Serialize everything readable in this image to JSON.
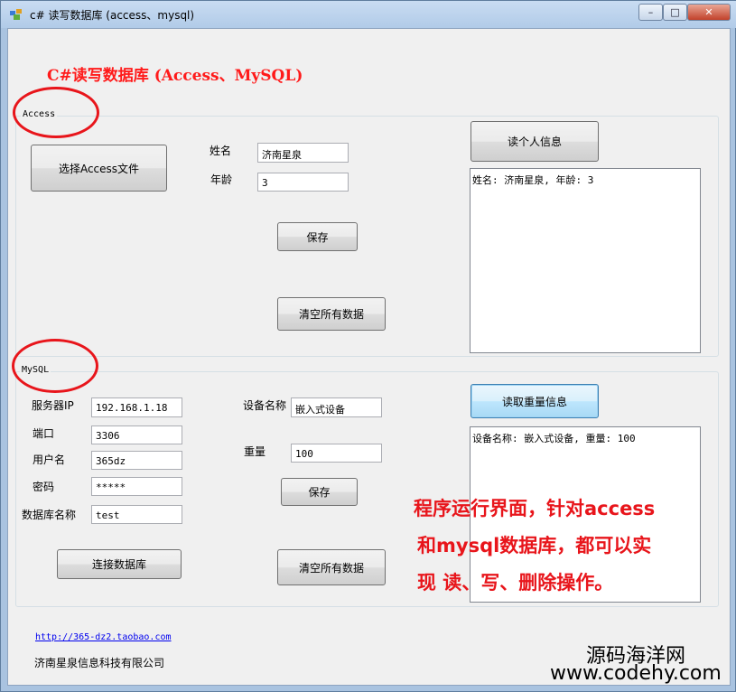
{
  "window": {
    "title": "c# 读写数据库 (access、mysql)",
    "controls": {
      "minimize": "–",
      "maximize": "□",
      "close": "✕"
    }
  },
  "heading": "C#读写数据库 (Access、MySQL)",
  "access": {
    "group_label": "Access",
    "select_file_button": "选择Access文件",
    "name_label": "姓名",
    "name_value": "济南星泉",
    "age_label": "年龄",
    "age_value": "3",
    "save_button": "保存",
    "clear_button": "清空所有数据",
    "read_button": "读个人信息",
    "output": "姓名: 济南星泉, 年龄: 3"
  },
  "mysql": {
    "group_label": "MySQL",
    "server_ip_label": "服务器IP",
    "server_ip_value": "192.168.1.18",
    "port_label": "端口",
    "port_value": "3306",
    "username_label": "用户名",
    "username_value": "365dz",
    "password_label": "密码",
    "password_value": "*****",
    "dbname_label": "数据库名称",
    "dbname_value": "test",
    "connect_button": "连接数据库",
    "device_name_label": "设备名称",
    "device_name_value": "嵌入式设备",
    "weight_label": "重量",
    "weight_value": "100",
    "save_button": "保存",
    "clear_button": "清空所有数据",
    "read_button": "读取重量信息",
    "output": "设备名称: 嵌入式设备, 重量: 100"
  },
  "footer": {
    "link": "http://365-dz2.taobao.com",
    "company": "济南星泉信息科技有限公司"
  },
  "annotation": {
    "line1": "程序运行界面，针对access",
    "line2": "和mysql数据库，都可以实",
    "line3": "现 读、写、删除操作。"
  },
  "watermark": {
    "cn": "源码海洋网",
    "url": "www.codehy.com"
  },
  "colors": {
    "annotation_red": "#e8151b",
    "window_frame": "#a9c3e0",
    "client_bg": "#f0f0f0"
  }
}
